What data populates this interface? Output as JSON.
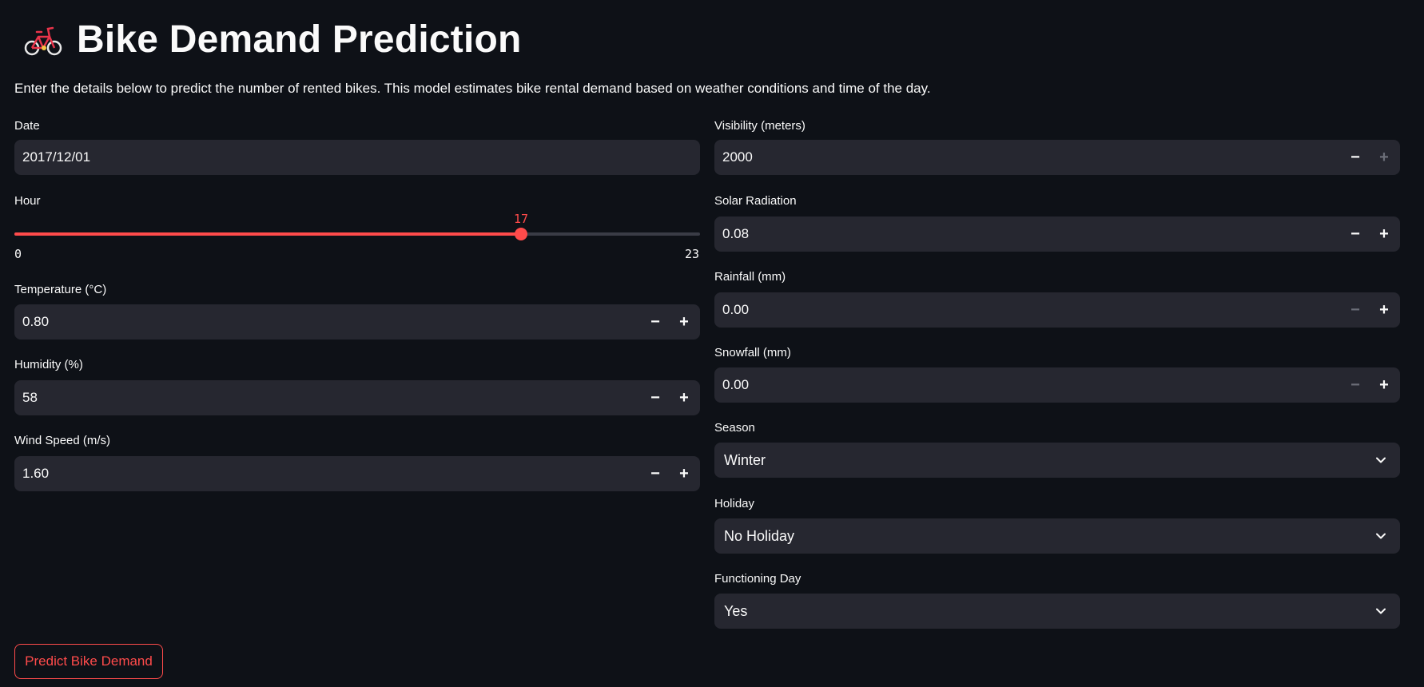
{
  "header": {
    "icon": "bicycle-icon",
    "title": "Bike Demand Prediction",
    "description": "Enter the details below to predict the number of rented bikes. This model estimates bike rental demand based on weather conditions and time of the day."
  },
  "colors": {
    "background": "#0e1117",
    "input_bg": "#262730",
    "accent": "#ff4b4b",
    "text": "#fafafa"
  },
  "left_column": {
    "date": {
      "label": "Date",
      "value": "2017/12/01"
    },
    "hour": {
      "label": "Hour",
      "value": "17",
      "min": "0",
      "max": "23",
      "fraction": 0.739
    },
    "temperature": {
      "label": "Temperature (°C)",
      "value": "0.80"
    },
    "humidity": {
      "label": "Humidity (%)",
      "value": "58"
    },
    "wind_speed": {
      "label": "Wind Speed (m/s)",
      "value": "1.60"
    }
  },
  "right_column": {
    "visibility": {
      "label": "Visibility (meters)",
      "value": "2000"
    },
    "solar_radiation": {
      "label": "Solar Radiation",
      "value": "0.08"
    },
    "rainfall": {
      "label": "Rainfall (mm)",
      "value": "0.00"
    },
    "snowfall": {
      "label": "Snowfall (mm)",
      "value": "0.00"
    },
    "season": {
      "label": "Season",
      "value": "Winter"
    },
    "holiday": {
      "label": "Holiday",
      "value": "No Holiday"
    },
    "functioning_day": {
      "label": "Functioning Day",
      "value": "Yes"
    }
  },
  "stepper": {
    "minus": "−",
    "plus": "+"
  },
  "predict_button": {
    "label": "Predict Bike Demand"
  }
}
